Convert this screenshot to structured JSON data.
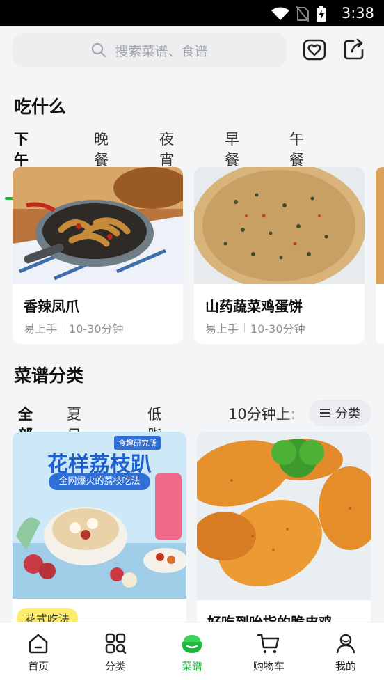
{
  "status_bar": {
    "time": "3:38"
  },
  "search": {
    "placeholder": "搜索菜谱、食谱"
  },
  "header_icons": [
    "heart-favorites-icon",
    "share-icon"
  ],
  "eat_section": {
    "title": "吃什么",
    "tabs": [
      {
        "label": "下午茶",
        "active": true
      },
      {
        "label": "晚餐",
        "active": false
      },
      {
        "label": "夜宵",
        "active": false
      },
      {
        "label": "早餐",
        "active": false
      },
      {
        "label": "午餐",
        "active": false
      }
    ],
    "cards": [
      {
        "name": "香辣凤爪",
        "difficulty": "易上手",
        "time": "10-30分钟"
      },
      {
        "name": "山药蔬菜鸡蛋饼",
        "difficulty": "易上手",
        "time": "10-30分钟"
      }
    ]
  },
  "recipe_section": {
    "title": "菜谱分类",
    "tabs": [
      {
        "label": "全部",
        "active": true
      },
      {
        "label": "夏日开胃",
        "active": false
      },
      {
        "label": "低脂美食",
        "active": false
      },
      {
        "label": "10分钟上:",
        "active": false
      }
    ],
    "filter_label": "分类",
    "cards": [
      {
        "poster_brand": "食趣研究所",
        "poster_title": "花样荔枝趴",
        "poster_subtitle": "全网爆火的荔枝吃法",
        "tag": "花式吃法"
      },
      {
        "title": "好吃到吮指的脆皮鸡"
      }
    ]
  },
  "bottom_nav": [
    {
      "label": "首页",
      "icon": "home-icon",
      "active": false
    },
    {
      "label": "分类",
      "icon": "category-grid-icon",
      "active": false
    },
    {
      "label": "菜谱",
      "icon": "recipe-bowl-icon",
      "active": true
    },
    {
      "label": "购物车",
      "icon": "cart-icon",
      "active": false
    },
    {
      "label": "我的",
      "icon": "profile-icon",
      "active": false
    }
  ],
  "colors": {
    "accent": "#1cb63c",
    "tag_bg": "#fdeb6b",
    "background": "#f4f5f7"
  }
}
